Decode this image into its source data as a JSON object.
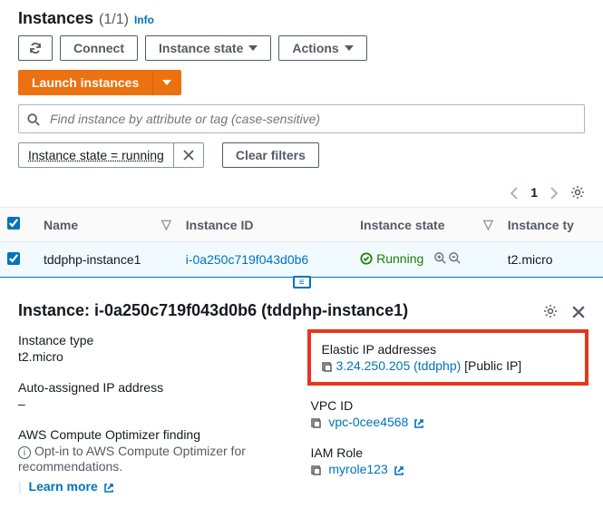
{
  "header": {
    "title": "Instances",
    "count": "(1/1)",
    "info": "Info"
  },
  "toolbar": {
    "connect": "Connect",
    "instance_state": "Instance state",
    "actions": "Actions",
    "launch": "Launch instances"
  },
  "search": {
    "placeholder": "Find instance by attribute or tag (case-sensitive)"
  },
  "filter": {
    "tag": "Instance state = running",
    "clear": "Clear filters"
  },
  "pagination": {
    "page": "1"
  },
  "table": {
    "headers": {
      "name": "Name",
      "instance_id": "Instance ID",
      "instance_state": "Instance state",
      "instance_type": "Instance ty"
    },
    "row": {
      "name": "tddphp-instance1",
      "instance_id": "i-0a250c719f043d0b6",
      "state": "Running",
      "type": "t2.micro"
    }
  },
  "detail": {
    "title": "Instance: i-0a250c719f043d0b6 (tddphp-instance1)",
    "left": {
      "instance_type_label": "Instance type",
      "instance_type": "t2.micro",
      "auto_ip_label": "Auto-assigned IP address",
      "auto_ip": "–",
      "optimizer_label": "AWS Compute Optimizer finding",
      "optimizer_text": "Opt-in to AWS Compute Optimizer for recommendations.",
      "learn_more": "Learn more"
    },
    "right": {
      "eip_label": "Elastic IP addresses",
      "eip_link": "3.24.250.205 (tddphp)",
      "eip_suffix": " [Public IP]",
      "vpc_label": "VPC ID",
      "vpc": "vpc-0cee4568",
      "iam_label": "IAM Role",
      "iam": "myrole123"
    }
  }
}
